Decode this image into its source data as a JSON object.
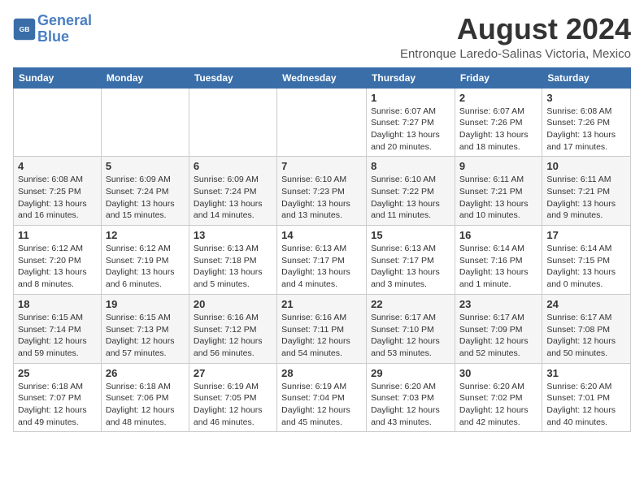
{
  "header": {
    "logo_line1": "General",
    "logo_line2": "Blue",
    "month_year": "August 2024",
    "location": "Entronque Laredo-Salinas Victoria, Mexico"
  },
  "weekdays": [
    "Sunday",
    "Monday",
    "Tuesday",
    "Wednesday",
    "Thursday",
    "Friday",
    "Saturday"
  ],
  "weeks": [
    [
      {
        "day": "",
        "info": ""
      },
      {
        "day": "",
        "info": ""
      },
      {
        "day": "",
        "info": ""
      },
      {
        "day": "",
        "info": ""
      },
      {
        "day": "1",
        "info": "Sunrise: 6:07 AM\nSunset: 7:27 PM\nDaylight: 13 hours\nand 20 minutes."
      },
      {
        "day": "2",
        "info": "Sunrise: 6:07 AM\nSunset: 7:26 PM\nDaylight: 13 hours\nand 18 minutes."
      },
      {
        "day": "3",
        "info": "Sunrise: 6:08 AM\nSunset: 7:26 PM\nDaylight: 13 hours\nand 17 minutes."
      }
    ],
    [
      {
        "day": "4",
        "info": "Sunrise: 6:08 AM\nSunset: 7:25 PM\nDaylight: 13 hours\nand 16 minutes."
      },
      {
        "day": "5",
        "info": "Sunrise: 6:09 AM\nSunset: 7:24 PM\nDaylight: 13 hours\nand 15 minutes."
      },
      {
        "day": "6",
        "info": "Sunrise: 6:09 AM\nSunset: 7:24 PM\nDaylight: 13 hours\nand 14 minutes."
      },
      {
        "day": "7",
        "info": "Sunrise: 6:10 AM\nSunset: 7:23 PM\nDaylight: 13 hours\nand 13 minutes."
      },
      {
        "day": "8",
        "info": "Sunrise: 6:10 AM\nSunset: 7:22 PM\nDaylight: 13 hours\nand 11 minutes."
      },
      {
        "day": "9",
        "info": "Sunrise: 6:11 AM\nSunset: 7:21 PM\nDaylight: 13 hours\nand 10 minutes."
      },
      {
        "day": "10",
        "info": "Sunrise: 6:11 AM\nSunset: 7:21 PM\nDaylight: 13 hours\nand 9 minutes."
      }
    ],
    [
      {
        "day": "11",
        "info": "Sunrise: 6:12 AM\nSunset: 7:20 PM\nDaylight: 13 hours\nand 8 minutes."
      },
      {
        "day": "12",
        "info": "Sunrise: 6:12 AM\nSunset: 7:19 PM\nDaylight: 13 hours\nand 6 minutes."
      },
      {
        "day": "13",
        "info": "Sunrise: 6:13 AM\nSunset: 7:18 PM\nDaylight: 13 hours\nand 5 minutes."
      },
      {
        "day": "14",
        "info": "Sunrise: 6:13 AM\nSunset: 7:17 PM\nDaylight: 13 hours\nand 4 minutes."
      },
      {
        "day": "15",
        "info": "Sunrise: 6:13 AM\nSunset: 7:17 PM\nDaylight: 13 hours\nand 3 minutes."
      },
      {
        "day": "16",
        "info": "Sunrise: 6:14 AM\nSunset: 7:16 PM\nDaylight: 13 hours\nand 1 minute."
      },
      {
        "day": "17",
        "info": "Sunrise: 6:14 AM\nSunset: 7:15 PM\nDaylight: 13 hours\nand 0 minutes."
      }
    ],
    [
      {
        "day": "18",
        "info": "Sunrise: 6:15 AM\nSunset: 7:14 PM\nDaylight: 12 hours\nand 59 minutes."
      },
      {
        "day": "19",
        "info": "Sunrise: 6:15 AM\nSunset: 7:13 PM\nDaylight: 12 hours\nand 57 minutes."
      },
      {
        "day": "20",
        "info": "Sunrise: 6:16 AM\nSunset: 7:12 PM\nDaylight: 12 hours\nand 56 minutes."
      },
      {
        "day": "21",
        "info": "Sunrise: 6:16 AM\nSunset: 7:11 PM\nDaylight: 12 hours\nand 54 minutes."
      },
      {
        "day": "22",
        "info": "Sunrise: 6:17 AM\nSunset: 7:10 PM\nDaylight: 12 hours\nand 53 minutes."
      },
      {
        "day": "23",
        "info": "Sunrise: 6:17 AM\nSunset: 7:09 PM\nDaylight: 12 hours\nand 52 minutes."
      },
      {
        "day": "24",
        "info": "Sunrise: 6:17 AM\nSunset: 7:08 PM\nDaylight: 12 hours\nand 50 minutes."
      }
    ],
    [
      {
        "day": "25",
        "info": "Sunrise: 6:18 AM\nSunset: 7:07 PM\nDaylight: 12 hours\nand 49 minutes."
      },
      {
        "day": "26",
        "info": "Sunrise: 6:18 AM\nSunset: 7:06 PM\nDaylight: 12 hours\nand 48 minutes."
      },
      {
        "day": "27",
        "info": "Sunrise: 6:19 AM\nSunset: 7:05 PM\nDaylight: 12 hours\nand 46 minutes."
      },
      {
        "day": "28",
        "info": "Sunrise: 6:19 AM\nSunset: 7:04 PM\nDaylight: 12 hours\nand 45 minutes."
      },
      {
        "day": "29",
        "info": "Sunrise: 6:20 AM\nSunset: 7:03 PM\nDaylight: 12 hours\nand 43 minutes."
      },
      {
        "day": "30",
        "info": "Sunrise: 6:20 AM\nSunset: 7:02 PM\nDaylight: 12 hours\nand 42 minutes."
      },
      {
        "day": "31",
        "info": "Sunrise: 6:20 AM\nSunset: 7:01 PM\nDaylight: 12 hours\nand 40 minutes."
      }
    ]
  ]
}
